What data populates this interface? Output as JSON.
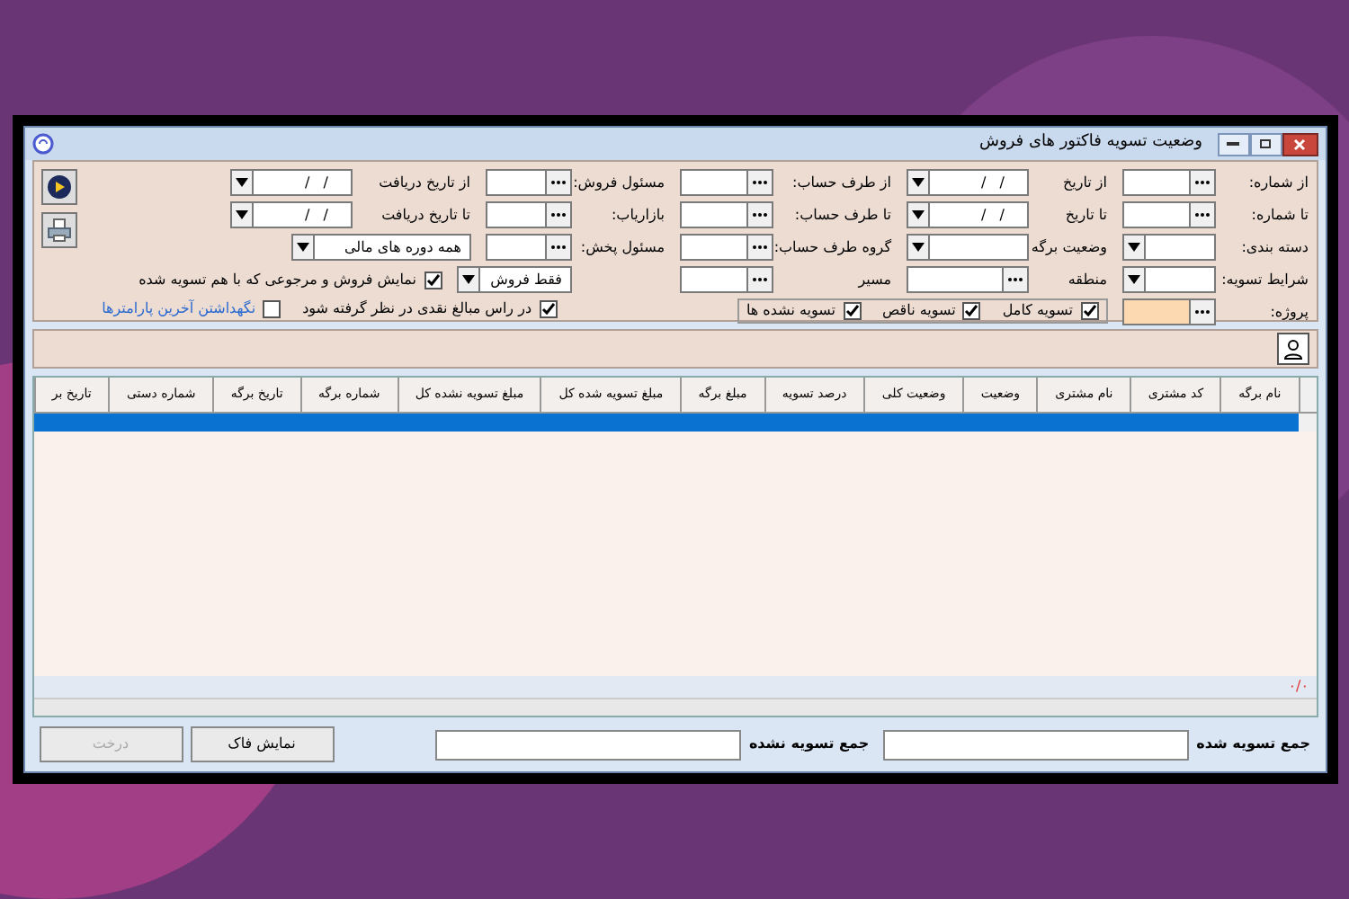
{
  "window": {
    "title": "وضعیت تسویه فاکتور های فروش"
  },
  "filters": {
    "column_1": [
      {
        "kind": "lookup",
        "label": "از شماره:"
      },
      {
        "kind": "lookup",
        "label": "تا شماره:"
      },
      {
        "kind": "dropdown",
        "label": "دسته بندی:"
      },
      {
        "kind": "dropdown",
        "label": "شرایط تسویه:"
      },
      {
        "kind": "lookup",
        "label": "پروژه:",
        "highlighted": true
      }
    ],
    "column_2": [
      {
        "kind": "date",
        "label": "از تاریخ",
        "value": "/   /"
      },
      {
        "kind": "date",
        "label": "تا تاریخ",
        "value": "/   /"
      },
      {
        "kind": "dropdown",
        "label": "وضعیت برگه"
      },
      {
        "kind": "lookup",
        "label": "منطقه"
      }
    ],
    "column_3": [
      {
        "kind": "lookup",
        "label": "از طرف حساب:"
      },
      {
        "kind": "lookup",
        "label": "تا طرف حساب:"
      },
      {
        "kind": "lookup",
        "label": "گروه طرف حساب:"
      },
      {
        "kind": "lookup",
        "label": "مسیر"
      }
    ],
    "column_4": [
      {
        "kind": "lookup",
        "label": "مسئول فروش:"
      },
      {
        "kind": "lookup",
        "label": "بازاریاب:"
      },
      {
        "kind": "lookup",
        "label": "مسئول پخش:"
      },
      {
        "kind": "dropdown",
        "value": "فقط فروش"
      }
    ],
    "column_5": [
      {
        "kind": "date",
        "label": "از تاریخ دریافت",
        "value": "/   /"
      },
      {
        "kind": "date",
        "label": "تا تاریخ دریافت",
        "value": "/   /"
      },
      {
        "kind": "dropdown",
        "value": "همه دوره های مالی"
      }
    ],
    "settlement": [
      {
        "label": "تسویه کامل",
        "checked": true
      },
      {
        "label": "تسویه ناقص",
        "checked": true
      },
      {
        "label": "تسویه نشده ها",
        "checked": true
      }
    ],
    "options": [
      {
        "label": "نمایش فروش و مرجوعی که با هم تسویه شده",
        "checked": true
      },
      {
        "label": "در راس مبالغ نقدی در نظر گرفته شود",
        "checked": true
      },
      {
        "label": "نگهداشتن آخرین پارامترها",
        "checked": false
      }
    ]
  },
  "table": {
    "columns": [
      "نام برگه",
      "کد مشتری",
      "نام مشتری",
      "وضعیت",
      "وضعیت کلی",
      "درصد تسویه",
      "مبلغ برگه",
      "مبلغ تسویه شده کل",
      "مبلغ تسویه نشده کل",
      "شماره برگه",
      "تاریخ برگه",
      "شماره دستی",
      "تاریخ بر"
    ],
    "rows": [
      {
        "selected": true
      }
    ],
    "footer": "۰/۰"
  },
  "totals": [
    {
      "label": "جمع تسویه شده"
    },
    {
      "label": "جمع تسویه نشده"
    }
  ],
  "buttons": [
    {
      "label": "نمایش فاک",
      "disabled": false
    },
    {
      "label": "درخت",
      "disabled": true
    }
  ]
}
